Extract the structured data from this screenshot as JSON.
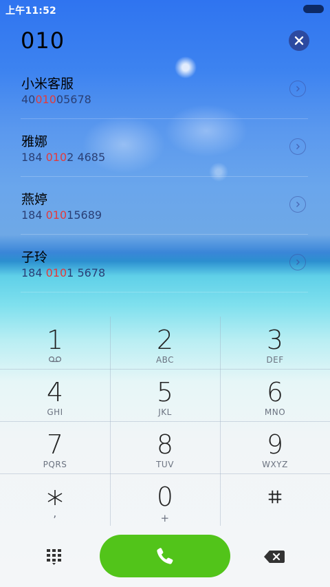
{
  "status_bar": {
    "time": "上午11:52"
  },
  "dialed_number": "010",
  "results": [
    {
      "name": "小米客服",
      "number_prefix": "40",
      "number_match": "010",
      "number_suffix": "05678"
    },
    {
      "name": "雅娜",
      "number_prefix": "184 ",
      "number_match": "010",
      "number_suffix": "2 4685"
    },
    {
      "name": "燕婷",
      "number_prefix": "184 ",
      "number_match": "010",
      "number_suffix": "15689"
    },
    {
      "name": "子玲",
      "number_prefix": "184 ",
      "number_match": "010",
      "number_suffix": "1 5678"
    }
  ],
  "keypad": [
    {
      "digit": "1",
      "letters": ""
    },
    {
      "digit": "2",
      "letters": "ABC"
    },
    {
      "digit": "3",
      "letters": "DEF"
    },
    {
      "digit": "4",
      "letters": "GHI"
    },
    {
      "digit": "5",
      "letters": "JKL"
    },
    {
      "digit": "6",
      "letters": "MNO"
    },
    {
      "digit": "7",
      "letters": "PQRS"
    },
    {
      "digit": "8",
      "letters": "TUV"
    },
    {
      "digit": "9",
      "letters": "WXYZ"
    },
    {
      "digit": "⁎",
      "letters": ","
    },
    {
      "digit": "0",
      "letters": "+"
    },
    {
      "digit": "#",
      "letters": ""
    }
  ],
  "icons": {
    "clear": "clear-icon",
    "arrow": "chevron-right-icon",
    "voicemail": "voicemail-icon",
    "dialpad": "dialpad-icon",
    "call": "phone-icon",
    "backspace": "backspace-icon"
  },
  "colors": {
    "call_button": "#52c41a",
    "match_highlight": "#e23b3b",
    "clear_button": "#2c4aa0"
  }
}
